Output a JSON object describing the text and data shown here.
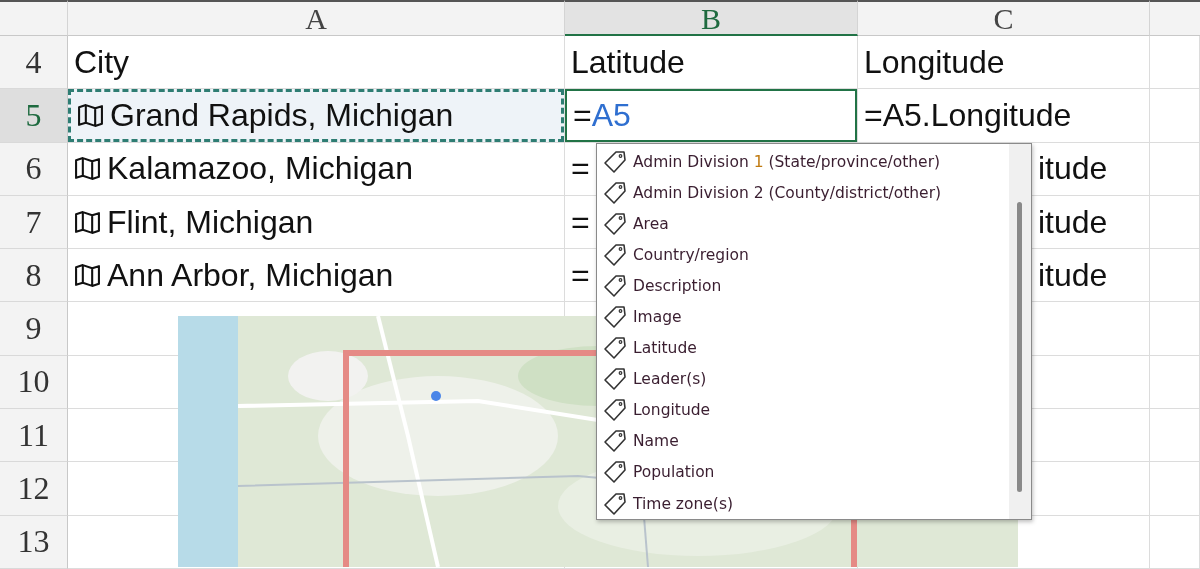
{
  "columns": [
    {
      "label": "A",
      "selected": false
    },
    {
      "label": "B",
      "selected": true
    },
    {
      "label": "C",
      "selected": false
    }
  ],
  "rows": [
    {
      "number": "4",
      "selected": false,
      "cells": [
        {
          "kind": "text",
          "text": "City"
        },
        {
          "kind": "text",
          "text": "Latitude"
        },
        {
          "kind": "text",
          "text": "Longitude"
        }
      ]
    },
    {
      "number": "5",
      "selected": true,
      "cells": [
        {
          "kind": "geography",
          "text": "Grand Rapids, Michigan",
          "copied": true
        },
        {
          "kind": "editing",
          "parts": [
            {
              "text": "="
            },
            {
              "text": "A5",
              "kind": "reference"
            }
          ]
        },
        {
          "kind": "text",
          "text": "=A5.Longitude"
        }
      ]
    },
    {
      "number": "6",
      "selected": false,
      "cells": [
        {
          "kind": "geography",
          "text": "Kalamazoo, Michigan",
          "copied": false
        },
        {
          "kind": "text",
          "text": "="
        },
        {
          "kind": "partial",
          "text": "itude"
        }
      ]
    },
    {
      "number": "7",
      "selected": false,
      "cells": [
        {
          "kind": "geography",
          "text": "Flint, Michigan",
          "copied": false
        },
        {
          "kind": "text",
          "text": "="
        },
        {
          "kind": "partial",
          "text": "itude"
        }
      ]
    },
    {
      "number": "8",
      "selected": false,
      "cells": [
        {
          "kind": "geography",
          "text": "Ann Arbor, Michigan",
          "copied": false
        },
        {
          "kind": "text",
          "text": "="
        },
        {
          "kind": "partial",
          "text": "itude"
        }
      ]
    },
    {
      "number": "9",
      "selected": false,
      "cells": []
    },
    {
      "number": "10",
      "selected": false,
      "cells": []
    },
    {
      "number": "11",
      "selected": false,
      "cells": []
    },
    {
      "number": "12",
      "selected": false,
      "cells": []
    },
    {
      "number": "13",
      "selected": false,
      "cells": []
    }
  ],
  "autocomplete": {
    "items": [
      {
        "parts": [
          {
            "text": "Admin Division "
          },
          {
            "text": "1",
            "kind": "highlight"
          },
          {
            "text": " (State/province/other)"
          }
        ]
      },
      {
        "parts": [
          {
            "text": "Admin Division 2 (County/district/other)"
          }
        ]
      },
      {
        "parts": [
          {
            "text": "Area"
          }
        ]
      },
      {
        "parts": [
          {
            "text": "Country/region"
          }
        ]
      },
      {
        "parts": [
          {
            "text": "Description"
          }
        ]
      },
      {
        "parts": [
          {
            "text": "Image"
          }
        ]
      },
      {
        "parts": [
          {
            "text": "Latitude"
          }
        ]
      },
      {
        "parts": [
          {
            "text": "Leader(s)"
          }
        ]
      },
      {
        "parts": [
          {
            "text": "Longitude"
          }
        ]
      },
      {
        "parts": [
          {
            "text": "Name"
          }
        ]
      },
      {
        "parts": [
          {
            "text": "Population"
          }
        ]
      },
      {
        "parts": [
          {
            "text": "Time zone(s)"
          }
        ]
      }
    ]
  }
}
